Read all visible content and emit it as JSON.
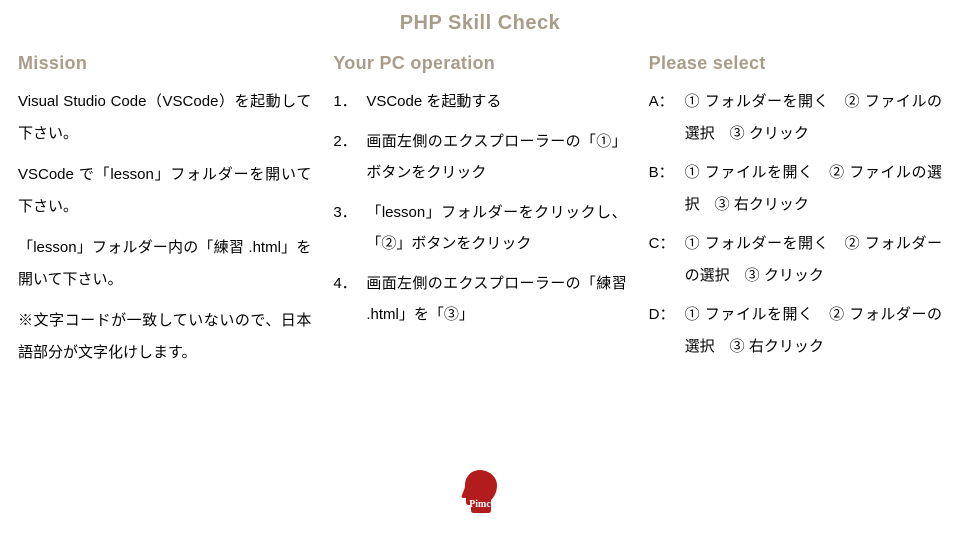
{
  "title": "PHP Skill Check",
  "mission": {
    "heading": "Mission",
    "paragraphs": [
      "Visual Studio Code（VSCode）を起動して下さい。",
      "VSCode で「lesson」フォルダーを開いて下さい。",
      "「lesson」フォルダー内の「練習 .html」を開いて下さい。",
      "※文字コードが一致していないので、日本語部分が文字化けします。"
    ]
  },
  "operation": {
    "heading": "Your PC operation",
    "steps": [
      "VSCode を起動する",
      "画面左側のエクスプローラーの「①」ボタンをクリック",
      "「lesson」フォルダーをクリックし、「②」ボタンをクリック",
      "画面左側のエクスプローラーの「練習 .html」を「③」"
    ]
  },
  "select": {
    "heading": "Please select",
    "choices": [
      {
        "label": "A：",
        "text": "① フォルダーを開く　② ファイルの選択　③ クリック"
      },
      {
        "label": "B：",
        "text": "① ファイルを開く　② ファイルの選択　③ 右クリック"
      },
      {
        "label": "C：",
        "text": "① フォルダーを開く　② フォルダーの選択　③ クリック"
      },
      {
        "label": "D：",
        "text": "① ファイルを開く　② フォルダーの選択　③ 右クリック"
      }
    ]
  },
  "logo": {
    "text": "Pimc",
    "color": "#b31c1c"
  }
}
